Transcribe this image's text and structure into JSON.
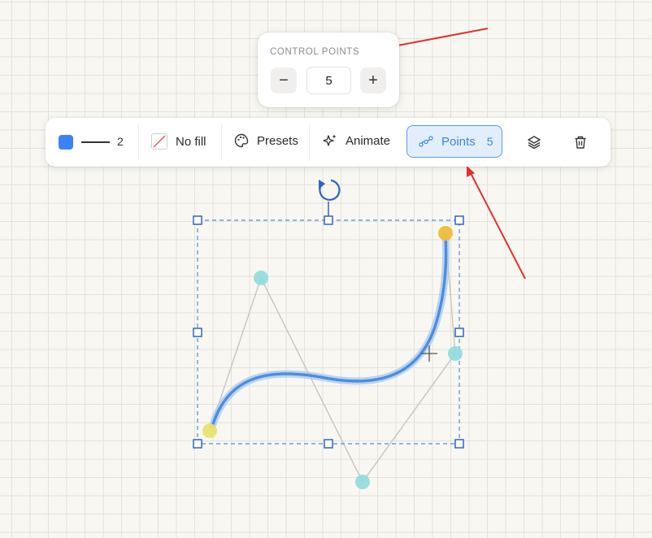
{
  "popover": {
    "title": "CONTROL POINTS",
    "minus": "−",
    "value": "5",
    "plus": "+"
  },
  "toolbar": {
    "color": "#3b82f6",
    "stroke_width": "2",
    "fill_label": "No fill",
    "presets_label": "Presets",
    "animate_label": "Animate",
    "points_label": "Points",
    "points_count": "5"
  },
  "canvas": {
    "curve_color": "#5b93de",
    "anchor_start_color": "#e8e06a",
    "anchor_end_color": "#f0bd3a",
    "control_point_color": "#8fdcdc",
    "annotation_color": "#e0332e"
  }
}
